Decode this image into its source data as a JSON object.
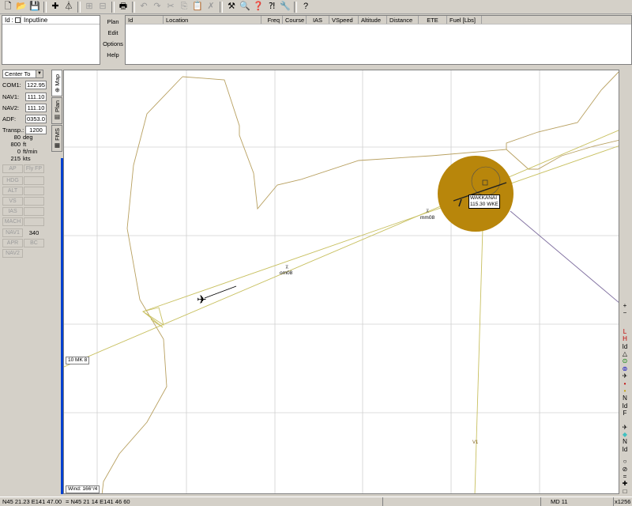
{
  "toolbar": {
    "buttons": [
      {
        "name": "new-icon",
        "glyph": "🗋",
        "enabled": true
      },
      {
        "name": "open-icon",
        "glyph": "📂",
        "enabled": true
      },
      {
        "name": "save-icon",
        "glyph": "💾",
        "enabled": true
      },
      {
        "name": "add-waypoint-icon",
        "glyph": "✚",
        "enabled": true
      },
      {
        "name": "airway-icon",
        "glyph": "⏃",
        "enabled": true
      },
      {
        "name": "insert-icon",
        "glyph": "⊞",
        "enabled": false
      },
      {
        "name": "remove-icon",
        "glyph": "⊟",
        "enabled": false
      },
      {
        "name": "print-icon",
        "glyph": "🖶",
        "enabled": true
      },
      {
        "name": "undo-icon",
        "glyph": "↶",
        "enabled": false
      },
      {
        "name": "redo-icon",
        "glyph": "↷",
        "enabled": false
      },
      {
        "name": "cut-icon",
        "glyph": "✂",
        "enabled": false
      },
      {
        "name": "copy-icon",
        "glyph": "⎘",
        "enabled": false
      },
      {
        "name": "paste-icon",
        "glyph": "📋",
        "enabled": false
      },
      {
        "name": "delete-icon",
        "glyph": "✗",
        "enabled": false
      },
      {
        "name": "hammer-icon",
        "glyph": "⚒",
        "enabled": true
      },
      {
        "name": "find-icon",
        "glyph": "🔍",
        "enabled": true
      },
      {
        "name": "help-topic-icon",
        "glyph": "❓",
        "enabled": true
      },
      {
        "name": "context-help-icon",
        "glyph": "⁈",
        "enabled": true
      },
      {
        "name": "tools-icon",
        "glyph": "🔧",
        "enabled": true
      },
      {
        "name": "about-icon",
        "glyph": "?",
        "enabled": true
      }
    ]
  },
  "input": {
    "id_label": "Id",
    "inputline_label": "Inputline"
  },
  "menu": {
    "items": [
      "Plan",
      "Edit",
      "Options",
      "Help"
    ]
  },
  "flightplan": {
    "columns": [
      "Id",
      "Location",
      "Freq",
      "Course",
      "IAS",
      "VSpeed",
      "Altitude",
      "Distance",
      "ETE",
      "Fuel [Lbs]"
    ]
  },
  "left_panel": {
    "center_select": "Center To",
    "radios": [
      {
        "label": "COM1:",
        "value": "122.95"
      },
      {
        "label": "NAV1:",
        "value": "111.10"
      },
      {
        "label": "NAV2:",
        "value": "111.10"
      },
      {
        "label": "ADF:",
        "value": "0353.0"
      },
      {
        "label": "Transp.:",
        "value": "1200"
      }
    ],
    "stats": [
      {
        "value": "80",
        "unit": "deg"
      },
      {
        "value": "800",
        "unit": "ft"
      },
      {
        "value": "0",
        "unit": "ft/min"
      },
      {
        "value": "215",
        "unit": "kts"
      }
    ],
    "autopilot": {
      "ap": "AP",
      "fly_fp": "Fly FP",
      "hdg": "HDG",
      "alt": "ALT",
      "vs": "VS",
      "ias": "IAS",
      "mach": "MACH",
      "nav1": "NAV1",
      "nav1_value": "340",
      "apr": "APR",
      "bc": "BC",
      "nav2": "NAV2"
    }
  },
  "tabs": {
    "map": "Map",
    "plan": "Plan",
    "fms": "FMS"
  },
  "map": {
    "vor_name": "WAKKANAI",
    "vor_freq_id": "115.30 WKE",
    "marker_mm": "mm08",
    "marker_om": "om08",
    "runway_label": "10 MK 8",
    "wind_label": "Wind: 166°/4",
    "route_label": "V1",
    "colors": {
      "coast": "#b8a060",
      "airway": "#c8c060",
      "vor_disc": "#b8860b",
      "route_line": "#8070a0",
      "grid": "#d0d0d0"
    }
  },
  "right_bar": {
    "items": [
      {
        "name": "zoom-in-icon",
        "glyph": "+",
        "color": "#000"
      },
      {
        "name": "zoom-out-icon",
        "glyph": "−",
        "color": "#000"
      },
      {
        "name": "low-airways-icon",
        "glyph": "L",
        "color": "#c00000"
      },
      {
        "name": "high-airways-icon",
        "glyph": "H",
        "color": "#c00000"
      },
      {
        "name": "airport-id-icon",
        "glyph": "Id",
        "color": "#000"
      },
      {
        "name": "triangle-icon",
        "glyph": "△",
        "color": "#000"
      },
      {
        "name": "vor-icon",
        "glyph": "⊙",
        "color": "#008000"
      },
      {
        "name": "ndb-icon",
        "glyph": "⊚",
        "color": "#0000c0"
      },
      {
        "name": "airport-icon",
        "glyph": "✈",
        "color": "#000"
      },
      {
        "name": "dot-red-icon",
        "glyph": "•",
        "color": "#c00000"
      },
      {
        "name": "dot-yellow-icon",
        "glyph": "•",
        "color": "#c0a000"
      },
      {
        "name": "navaid-n-icon",
        "glyph": "N",
        "color": "#000"
      },
      {
        "name": "navaid-id-icon",
        "glyph": "Id",
        "color": "#000"
      },
      {
        "name": "fix-f-icon",
        "glyph": "F",
        "color": "#000"
      },
      {
        "name": "plane-icon",
        "glyph": "✈",
        "color": "#000"
      },
      {
        "name": "diamond-icon",
        "glyph": "◆",
        "color": "#40c0c0"
      },
      {
        "name": "name-n-icon",
        "glyph": "N",
        "color": "#000"
      },
      {
        "name": "name-id-icon",
        "glyph": "Id",
        "color": "#000"
      },
      {
        "name": "circle-icon",
        "glyph": "○",
        "color": "#000"
      },
      {
        "name": "lock-icon",
        "glyph": "⊘",
        "color": "#000"
      },
      {
        "name": "equals-icon",
        "glyph": "=",
        "color": "#000"
      },
      {
        "name": "cross-icon",
        "glyph": "✚",
        "color": "#000"
      },
      {
        "name": "square-icon",
        "glyph": "□",
        "color": "#000"
      },
      {
        "name": "nav-icon",
        "glyph": "±",
        "color": "#000"
      }
    ]
  },
  "status_bar": {
    "lat": "N45 21.23",
    "lon": "E141 47.00",
    "range": "= N45 21 14",
    "range2": "E141 46 60",
    "md": "MD 11",
    "zoom": "x1256"
  }
}
